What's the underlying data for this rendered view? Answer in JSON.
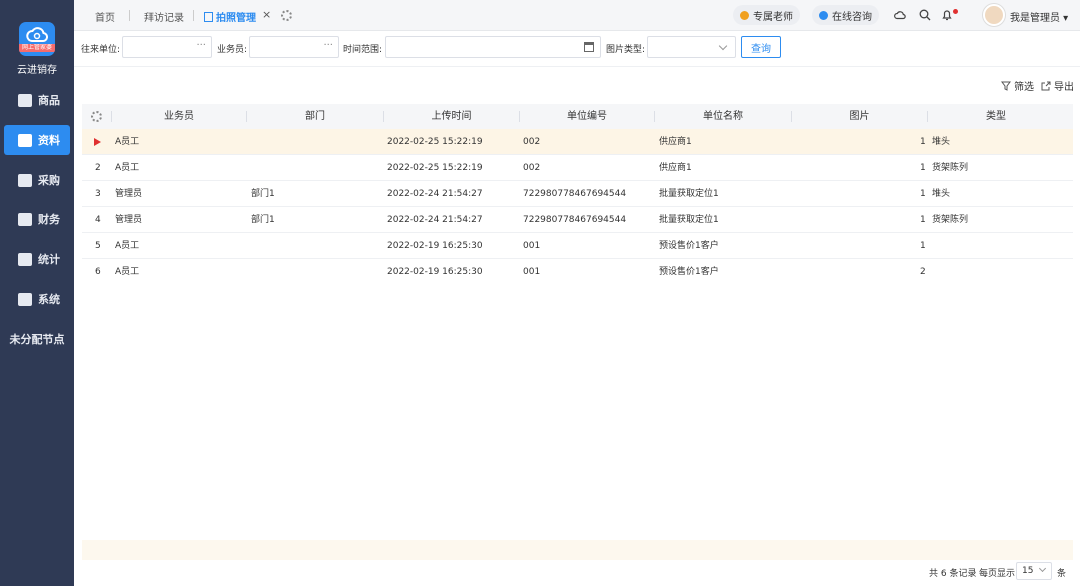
{
  "sidebar": {
    "logo_text": "网上管家婆",
    "brand": "云进销存",
    "items": [
      {
        "label": "商品"
      },
      {
        "label": "资料"
      },
      {
        "label": "采购"
      },
      {
        "label": "财务"
      },
      {
        "label": "统计"
      },
      {
        "label": "系统"
      },
      {
        "label": "未分配节点"
      }
    ]
  },
  "tabs": {
    "home": "首页",
    "visit": "拜访记录",
    "photo": "拍照管理"
  },
  "header": {
    "teacher": "专属老师",
    "consult": "在线咨询",
    "user": "我是管理员"
  },
  "filters": {
    "partner_label": "往来单位:",
    "salesman_label": "业务员:",
    "time_label": "时间范围:",
    "image_type_label": "图片类型:",
    "query": "查询"
  },
  "actions": {
    "filter": "筛选",
    "export": "导出"
  },
  "table": {
    "columns": [
      "业务员",
      "部门",
      "上传时间",
      "单位编号",
      "单位名称",
      "图片",
      "类型"
    ],
    "rows": [
      {
        "no": "",
        "salesman": "A员工",
        "dept": "",
        "time": "2022-02-25 15:22:19",
        "code": "002",
        "name": "供应商1",
        "img": "1",
        "type": "堆头"
      },
      {
        "no": "2",
        "salesman": "A员工",
        "dept": "",
        "time": "2022-02-25 15:22:19",
        "code": "002",
        "name": "供应商1",
        "img": "1",
        "type": "货架陈列"
      },
      {
        "no": "3",
        "salesman": "管理员",
        "dept": "部门1",
        "time": "2022-02-24 21:54:27",
        "code": "722980778467694544",
        "name": "批量获取定位1",
        "img": "1",
        "type": "堆头"
      },
      {
        "no": "4",
        "salesman": "管理员",
        "dept": "部门1",
        "time": "2022-02-24 21:54:27",
        "code": "722980778467694544",
        "name": "批量获取定位1",
        "img": "1",
        "type": "货架陈列"
      },
      {
        "no": "5",
        "salesman": "A员工",
        "dept": "",
        "time": "2022-02-19 16:25:30",
        "code": "001",
        "name": "预设售价1客户",
        "img": "1",
        "type": ""
      },
      {
        "no": "6",
        "salesman": "A员工",
        "dept": "",
        "time": "2022-02-19 16:25:30",
        "code": "001",
        "name": "预设售价1客户",
        "img": "2",
        "type": ""
      }
    ]
  },
  "pager": {
    "total": "共 6 条记录",
    "per_page": "每页显示",
    "size": "15",
    "unit": "条"
  },
  "colors": {
    "sidebar_bg": "#2f3a55",
    "accent": "#2d8cf0",
    "selected_row": "#fdf5e6"
  }
}
